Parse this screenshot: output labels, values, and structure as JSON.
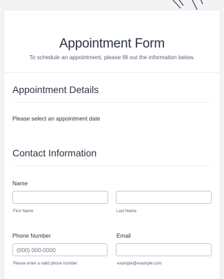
{
  "form": {
    "title": "Appointment Form",
    "subtitle": "To schedule an appointment, please fill out the information below."
  },
  "appointment_section": {
    "heading": "Appointment Details",
    "date_prompt": "Please select an appointment date"
  },
  "contact_section": {
    "heading": "Contact Information",
    "name": {
      "label": "Name",
      "first_value": "",
      "first_sublabel": "First Name",
      "last_value": "",
      "last_sublabel": "Last Name"
    },
    "phone": {
      "label": "Phone Number",
      "placeholder": "(000) 000-0000",
      "sublabel": "Please enter a valid phone number."
    },
    "email": {
      "label": "Email",
      "value": "",
      "sublabel": "example@example.com"
    }
  },
  "colors": {
    "text": "#2c3345",
    "muted": "#57647e",
    "border": "#c3cad8",
    "background": "#f3f3f6"
  }
}
